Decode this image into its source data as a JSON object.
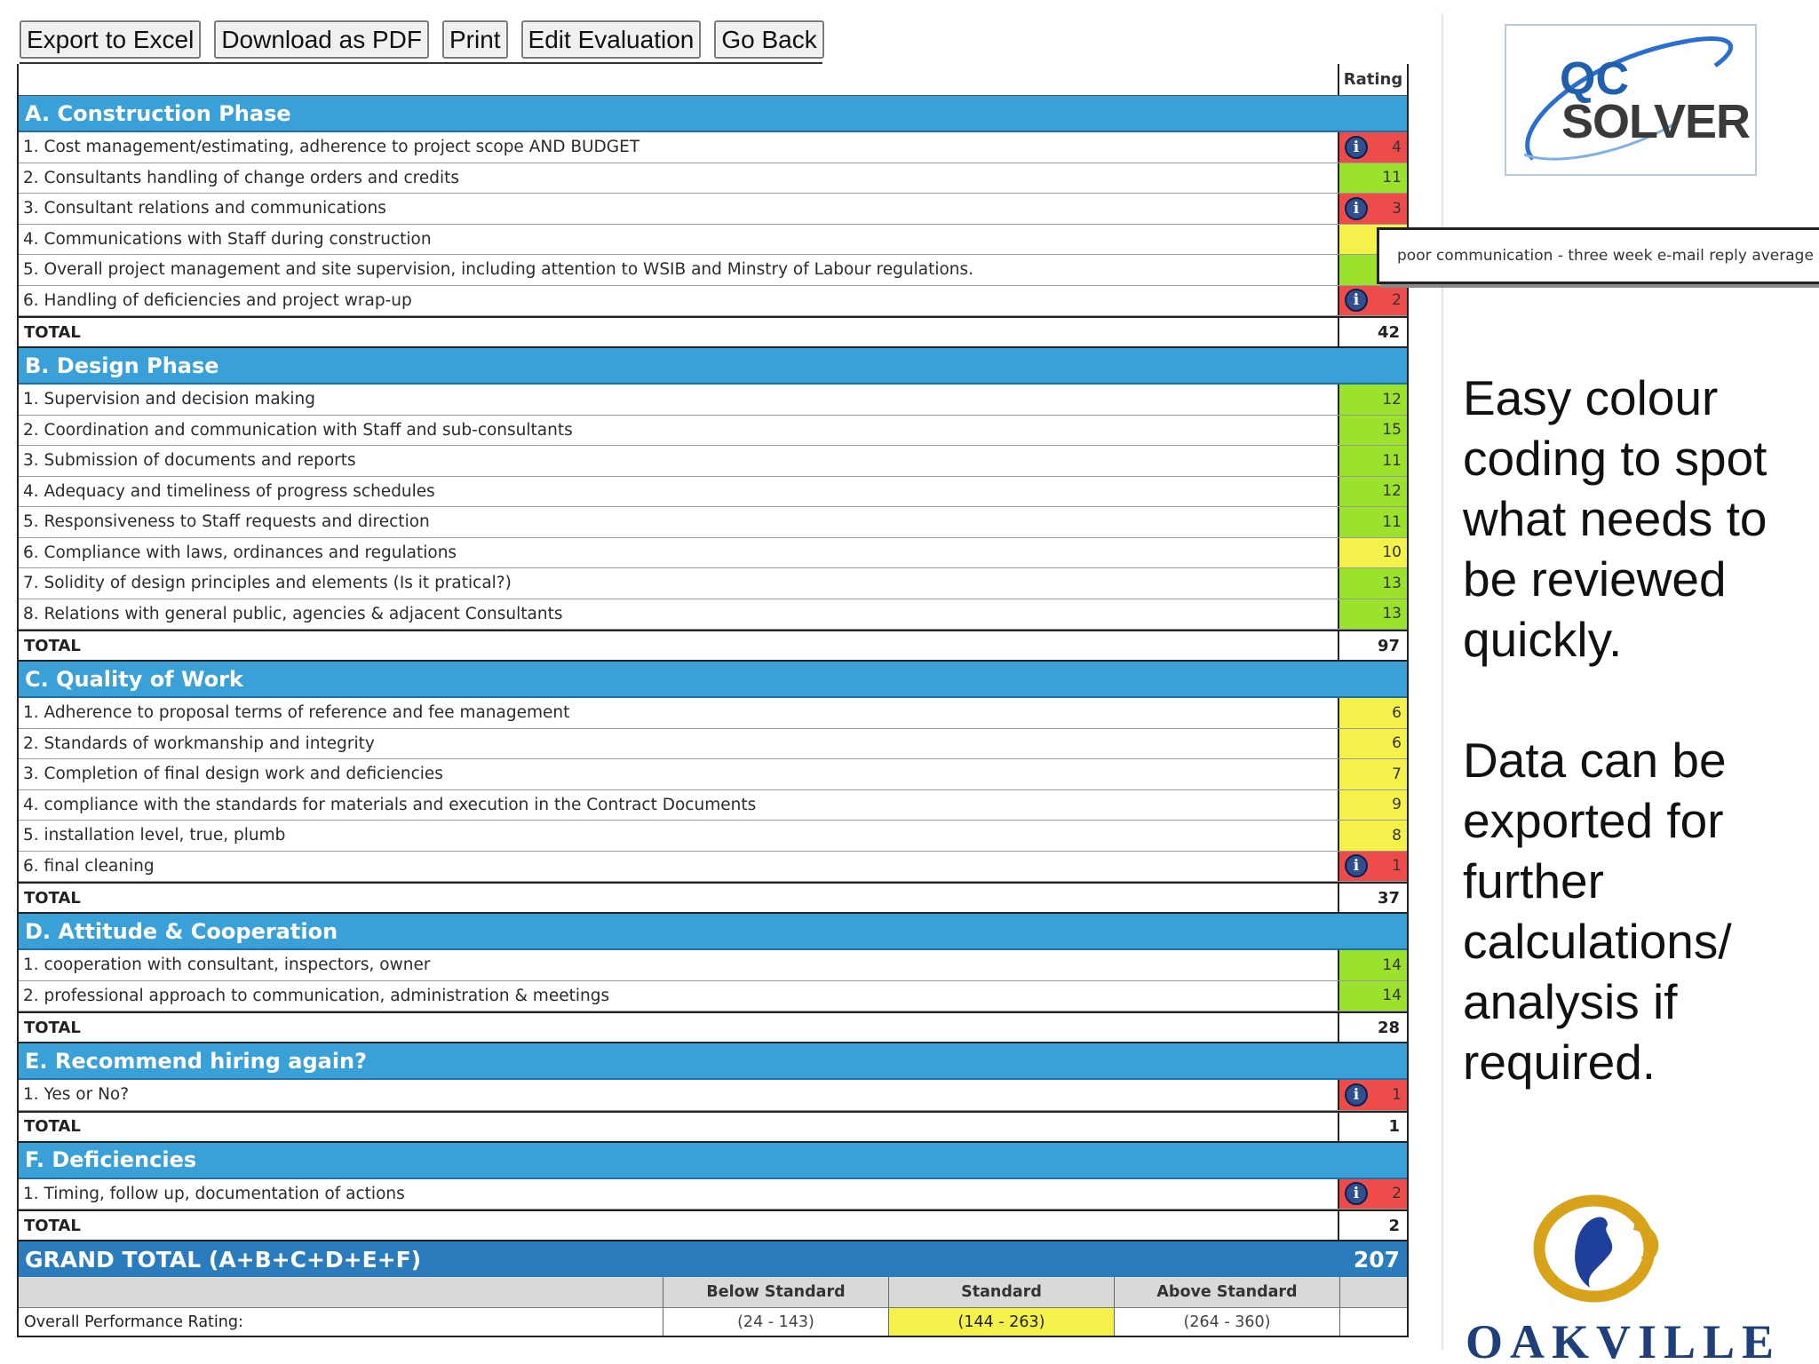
{
  "toolbar": {
    "buttons": [
      "Export to Excel",
      "Download as PDF",
      "Print",
      "Edit Evaluation",
      "Go Back"
    ]
  },
  "table": {
    "rating_header": "Rating",
    "total_label": "TOTAL",
    "sections": [
      {
        "title": "A. Construction Phase",
        "items": [
          {
            "label": "1. Cost management/estimating, adherence to project scope AND BUDGET",
            "rating": "4",
            "color": "#ee4b4b",
            "info": true
          },
          {
            "label": "2. Consultants handling of change orders and credits",
            "rating": "11",
            "color": "#9be22d",
            "info": false
          },
          {
            "label": "3. Consultant relations and communications",
            "rating": "3",
            "color": "#ee4b4b",
            "info": true
          },
          {
            "label": "4. Communications with Staff during construction",
            "rating": "",
            "color": "#f4f24a",
            "info": false
          },
          {
            "label": "5. Overall project management and site supervision, including attention to WSIB and Minstry of Labour regulations.",
            "rating": "",
            "color": "#9be22d",
            "info": false
          },
          {
            "label": "6. Handling of deficiencies and project wrap-up",
            "rating": "2",
            "color": "#ee4b4b",
            "info": true
          }
        ],
        "total": "42"
      },
      {
        "title": "B. Design Phase",
        "items": [
          {
            "label": "1. Supervision and decision making",
            "rating": "12",
            "color": "#9be22d",
            "info": false
          },
          {
            "label": "2. Coordination and communication with Staff and sub-consultants",
            "rating": "15",
            "color": "#9be22d",
            "info": false
          },
          {
            "label": "3. Submission of documents and reports",
            "rating": "11",
            "color": "#9be22d",
            "info": false
          },
          {
            "label": "4. Adequacy and timeliness of progress schedules",
            "rating": "12",
            "color": "#9be22d",
            "info": false
          },
          {
            "label": "5. Responsiveness to Staff requests and direction",
            "rating": "11",
            "color": "#9be22d",
            "info": false
          },
          {
            "label": "6. Compliance with laws, ordinances and regulations",
            "rating": "10",
            "color": "#f4f24a",
            "info": false
          },
          {
            "label": "7. Solidity of design principles and elements (Is it pratical?)",
            "rating": "13",
            "color": "#9be22d",
            "info": false
          },
          {
            "label": "8. Relations with general public, agencies & adjacent Consultants",
            "rating": "13",
            "color": "#9be22d",
            "info": false
          }
        ],
        "total": "97"
      },
      {
        "title": "C. Quality of Work",
        "items": [
          {
            "label": "1. Adherence to proposal terms of reference and fee management",
            "rating": "6",
            "color": "#f4f24a",
            "info": false
          },
          {
            "label": "2. Standards of workmanship and integrity",
            "rating": "6",
            "color": "#f4f24a",
            "info": false
          },
          {
            "label": "3. Completion of final design work and deficiencies",
            "rating": "7",
            "color": "#f4f24a",
            "info": false
          },
          {
            "label": "4. compliance with the standards for materials and execution in the Contract Documents",
            "rating": "9",
            "color": "#f4f24a",
            "info": false
          },
          {
            "label": "5. installation level, true, plumb",
            "rating": "8",
            "color": "#f4f24a",
            "info": false
          },
          {
            "label": "6. final cleaning",
            "rating": "1",
            "color": "#ee4b4b",
            "info": true
          }
        ],
        "total": "37"
      },
      {
        "title": "D. Attitude & Cooperation",
        "items": [
          {
            "label": "1. cooperation with consultant, inspectors, owner",
            "rating": "14",
            "color": "#9be22d",
            "info": false
          },
          {
            "label": "2. professional approach to communication, administration & meetings",
            "rating": "14",
            "color": "#9be22d",
            "info": false
          }
        ],
        "total": "28"
      },
      {
        "title": "E. Recommend hiring again?",
        "items": [
          {
            "label": "1. Yes or No?",
            "rating": "1",
            "color": "#ee4b4b",
            "info": true
          }
        ],
        "total": "1"
      },
      {
        "title": "F. Deficiencies",
        "items": [
          {
            "label": "1. Timing, follow up, documentation of actions",
            "rating": "2",
            "color": "#ee4b4b",
            "info": true
          }
        ],
        "total": "2"
      }
    ],
    "grand_total": {
      "label": "GRAND TOTAL (A+B+C+D+E+F)",
      "value": "207"
    }
  },
  "performance": {
    "headers": [
      "Below Standard",
      "Standard",
      "Above Standard"
    ],
    "row_label": "Overall Performance Rating:",
    "ranges": [
      "(24 - 143)",
      "(144 - 263)",
      "(264 - 360)"
    ],
    "highlight_color": "#f4f24a"
  },
  "tooltip": {
    "text": "poor communication - three week e-mail reply average"
  },
  "logo": {
    "line1": "QC",
    "line2": "SOLVER"
  },
  "blurb": {
    "paragraph1": "Easy colour coding to spot what needs to be reviewed quickly.",
    "paragraph2": "Data can be exported for further calculations/ analysis if required."
  },
  "oakville": {
    "wordmark": "OAKVILLE"
  }
}
